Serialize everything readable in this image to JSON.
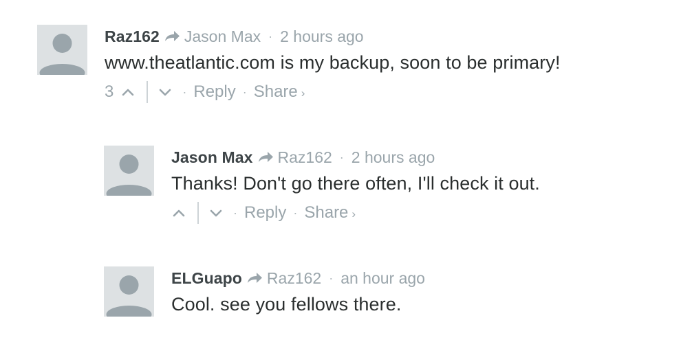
{
  "colors": {
    "author": "#3d4447",
    "muted": "#9aa5ab",
    "text": "#2a2e2e",
    "avatar_bg": "#dde1e3",
    "avatar_fg": "#9aa5ab"
  },
  "separator": "·",
  "comments": [
    {
      "author": "Raz162",
      "in_reply_to": "Jason Max",
      "time": "2 hours ago",
      "text": "www.theatlantic.com is my backup, soon to be primary!",
      "votes": "3",
      "reply_label": "Reply",
      "share_label": "Share",
      "share_chevron": "›",
      "avatar_icon": "default-avatar-icon",
      "reply_arrow_icon": "reply-arrow-icon"
    },
    {
      "author": "Jason Max",
      "in_reply_to": "Raz162",
      "time": "2 hours ago",
      "text": "Thanks! Don't go there often, I'll check it out.",
      "votes": "",
      "reply_label": "Reply",
      "share_label": "Share",
      "share_chevron": "›",
      "avatar_icon": "default-avatar-icon",
      "reply_arrow_icon": "reply-arrow-icon"
    },
    {
      "author": "ELGuapo",
      "in_reply_to": "Raz162",
      "time": "an hour ago",
      "text": "Cool. see you fellows there.",
      "avatar_icon": "default-avatar-icon",
      "reply_arrow_icon": "reply-arrow-icon"
    }
  ]
}
